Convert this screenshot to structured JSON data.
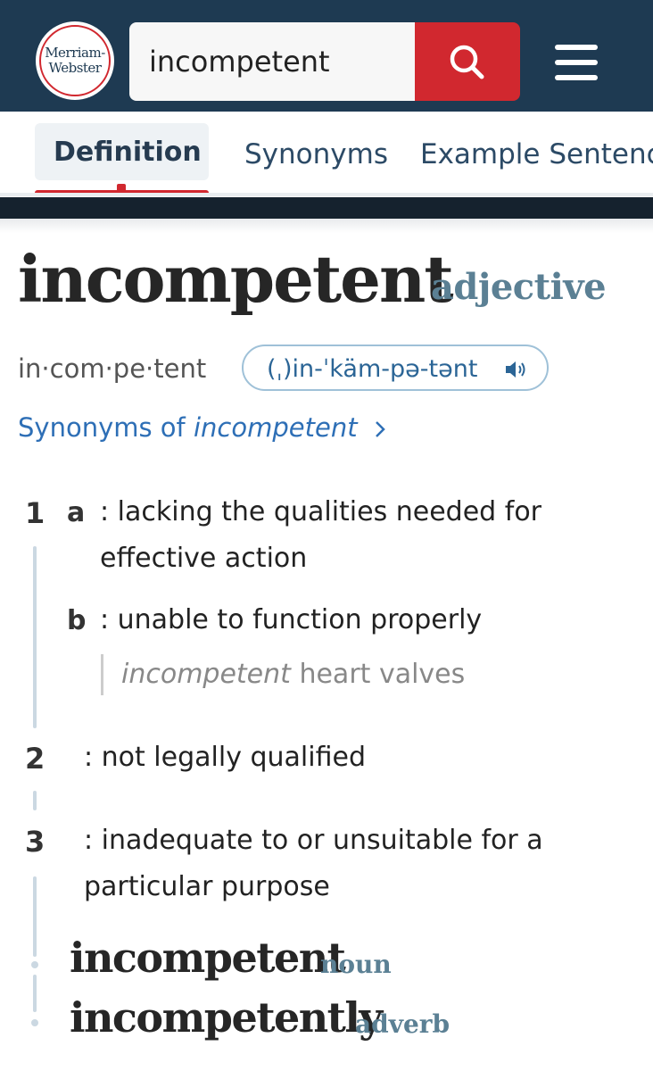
{
  "header": {
    "logo_line1": "Merriam-",
    "logo_line2": "Webster",
    "search_value": "incompetent",
    "brand_red": "#d1282f",
    "header_bg": "#1e3a52"
  },
  "tabs": [
    {
      "label": "Definition",
      "active": true
    },
    {
      "label": "Synonyms",
      "active": false
    },
    {
      "label": "Example Sentenc",
      "active": false
    }
  ],
  "entry": {
    "headword": "incompetent",
    "part_of_speech": "adjective",
    "syllables": "in·com·pe·tent",
    "pronunciation": "(ˌ)in-ˈkäm-pə-tənt",
    "synonyms_prefix": "Synonyms of ",
    "synonyms_word": "incompetent"
  },
  "senses": [
    {
      "number": "1",
      "letter": "a",
      "text": ": lacking the qualities needed for effective action"
    },
    {
      "letter": "b",
      "text": ": unable to function properly",
      "example_word": "incompetent",
      "example_rest": " heart valves"
    },
    {
      "number": "2",
      "text": ": not legally qualified"
    },
    {
      "number": "3",
      "text": ": inadequate to or unsuitable for a particular purpose"
    }
  ],
  "run_ons": [
    {
      "word": "incompetent",
      "pos": "noun"
    },
    {
      "word": "incompetently",
      "pos": "adverb"
    }
  ],
  "icons": [
    "search-icon",
    "menu-icon",
    "speaker-icon",
    "chevron-right-icon"
  ]
}
